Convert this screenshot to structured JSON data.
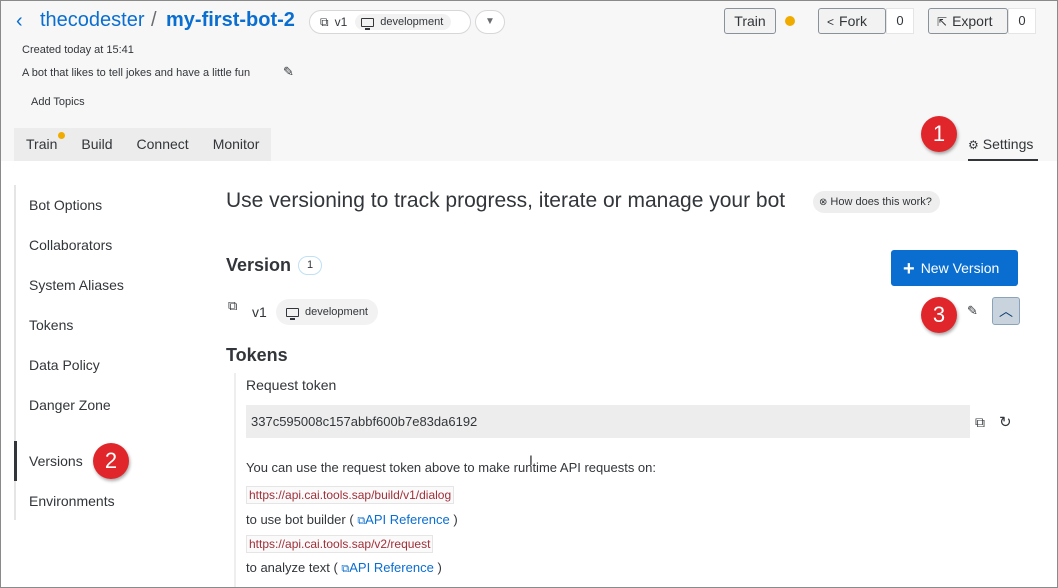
{
  "header": {
    "back_icon": "‹",
    "breadcrumb_owner": "thecodester",
    "breadcrumb_separator": "/",
    "breadcrumb_bot": "my-first-bot-2",
    "version_selector": {
      "version": "v1",
      "environment": "development"
    },
    "train_button": "Train",
    "train_status_color": "#f0ab00",
    "fork_button": "Fork",
    "fork_count": "0",
    "export_button": "Export",
    "export_count": "0",
    "created": "Created today at 15:41",
    "description": "A bot that likes to tell jokes and have a little fun",
    "add_topics": "Add Topics"
  },
  "tabs": [
    {
      "label": "Train",
      "has_indicator": true
    },
    {
      "label": "Build"
    },
    {
      "label": "Connect"
    },
    {
      "label": "Monitor"
    }
  ],
  "settings_tab": "Settings",
  "sidebar": {
    "items": [
      {
        "label": "Bot Options"
      },
      {
        "label": "Collaborators"
      },
      {
        "label": "System Aliases"
      },
      {
        "label": "Tokens"
      },
      {
        "label": "Data Policy"
      },
      {
        "label": "Danger Zone"
      },
      {
        "label": "Versions",
        "active": true
      },
      {
        "label": "Environments"
      }
    ]
  },
  "main": {
    "title": "Use versioning to track progress, iterate or manage your bot",
    "how_it_works": "How does this work?",
    "version_section": "Version",
    "version_count": "1",
    "new_version_button": "New Version",
    "version_row": {
      "label": "v1",
      "environment": "development"
    },
    "tokens_section": "Tokens",
    "request_token_label": "Request token",
    "request_token": "337c595008c157abbf600b7e83da6192",
    "info_text": "You can use the request token above to make runtime API requests on:",
    "url_dialog": "https://api.cai.tools.sap/build/v1/dialog",
    "to_use_builder": "to use bot builder (",
    "url_request": "https://api.cai.tools.sap/v2/request",
    "to_analyze": "to analyze text (",
    "api_reference": "API Reference",
    "close_paren": ")"
  },
  "markers": [
    "1",
    "2",
    "3"
  ],
  "colors": {
    "accent": "#0a6ed1",
    "marker": "#e0262b",
    "indicator": "#f0ab00"
  }
}
